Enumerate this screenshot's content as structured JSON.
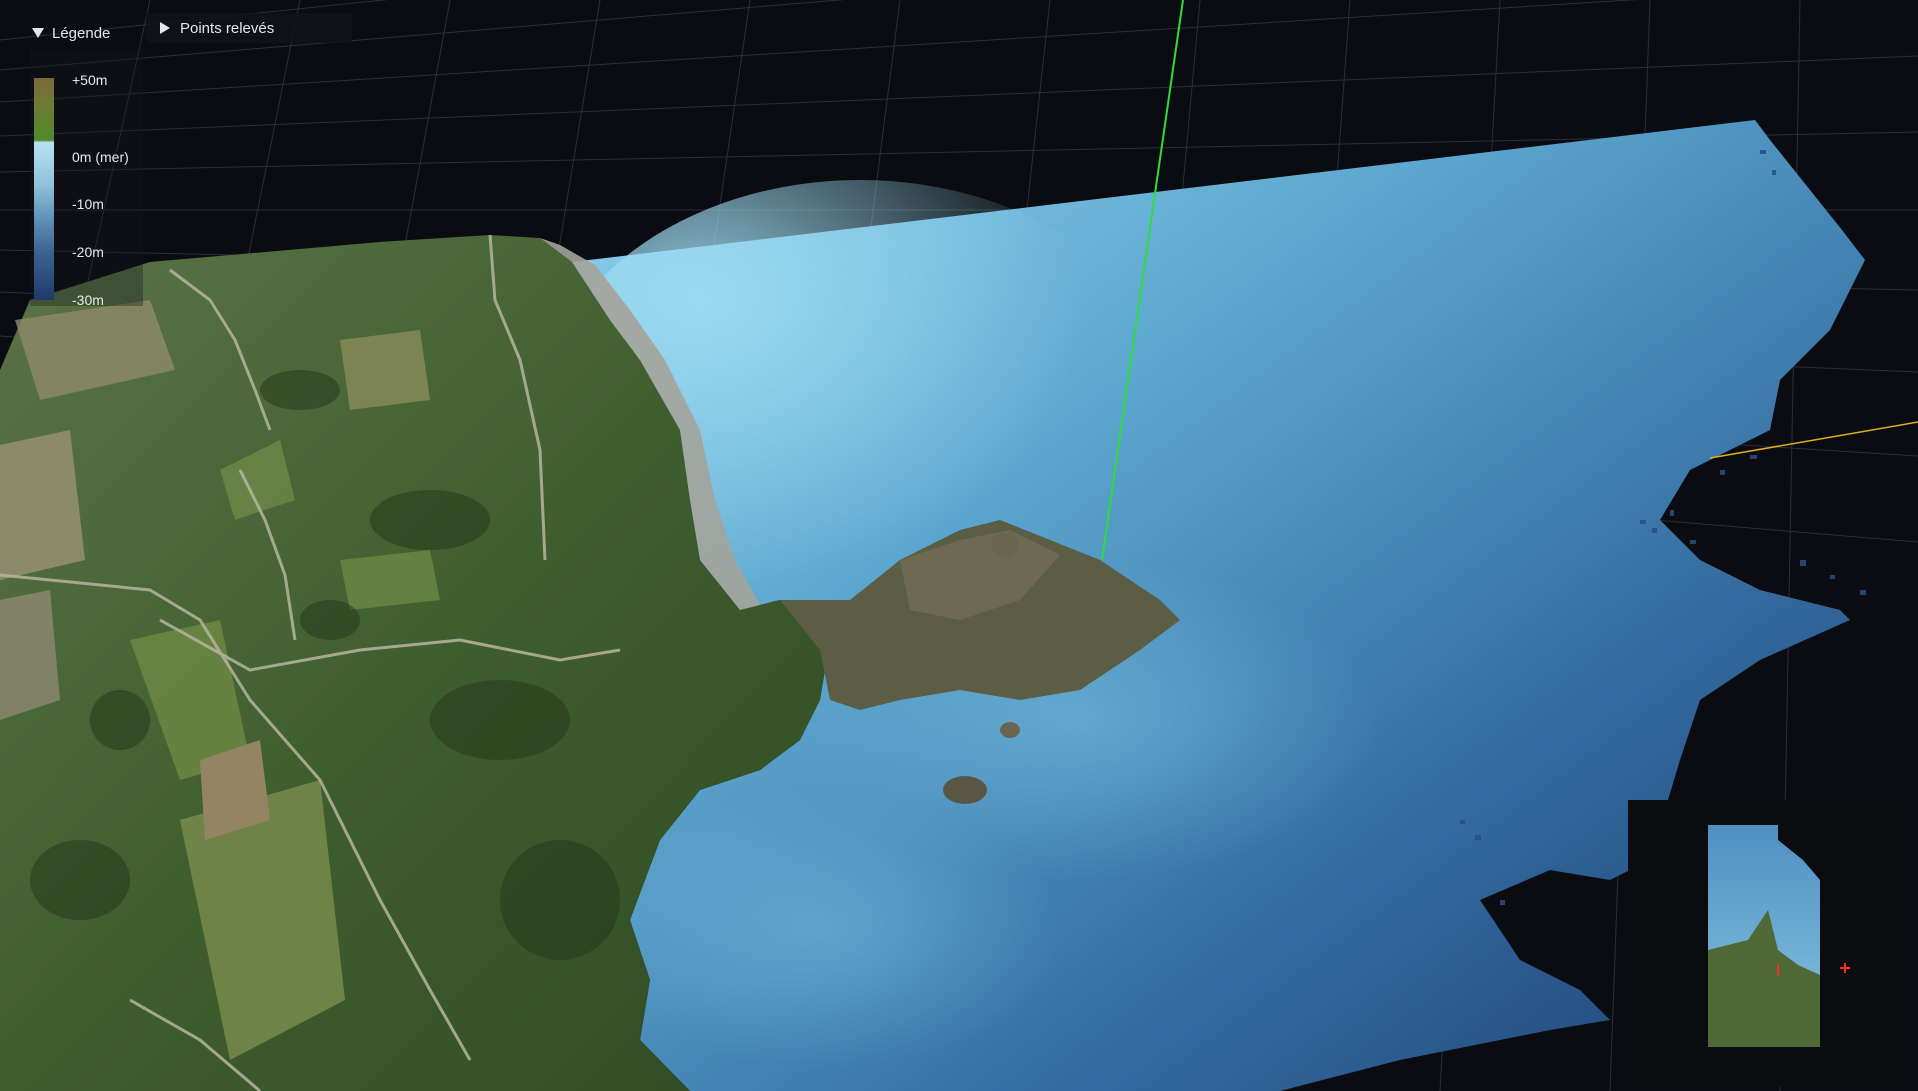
{
  "legend": {
    "title": "Légende",
    "labels": {
      "top": "+50m",
      "sea_level": "0m (mer)",
      "minus10": "-10m",
      "minus20": "-20m",
      "minus30": "-30m"
    }
  },
  "layers": {
    "points_label": "Points relevés"
  },
  "colors": {
    "background": "#0b0c11",
    "grid": "#2b2e38",
    "sea_shallow": "#8fd0ea",
    "sea_deep": "#1e3d6e",
    "land": "#4a6a35",
    "axis_green": "#2fdc3a",
    "axis_yellow": "#e0b020",
    "marker_red": "#ff2a2a"
  },
  "icons": {
    "legend_toggle": "caret-down-icon",
    "points_toggle": "caret-right-icon",
    "minimap_marker": "crosshair-icon"
  }
}
